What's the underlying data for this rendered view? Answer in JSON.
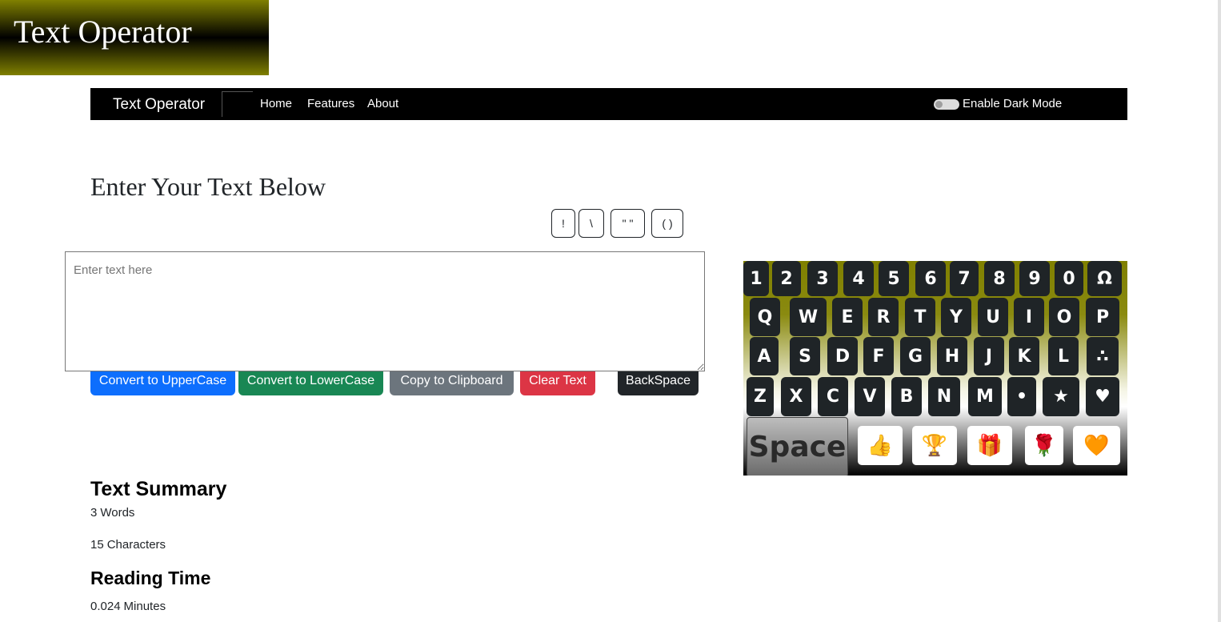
{
  "site_title": "Text Operator",
  "navbar": {
    "brand": "Text Operator",
    "links": [
      "Home",
      "Features",
      "About"
    ],
    "dark_mode_label": "Enable Dark Mode"
  },
  "main": {
    "heading": "Enter Your Text Below",
    "symbol_buttons": [
      "!",
      "\\",
      "\" \"",
      "( )"
    ],
    "textarea_placeholder": "Enter text here",
    "actions": {
      "upper": "Convert to UpperCase",
      "lower": "Convert to LowerCase",
      "copy": "Copy to Clipboard",
      "clear": "Clear Text",
      "backspace": "BackSpace"
    }
  },
  "keyboard": {
    "row1": [
      "1",
      "2",
      "3",
      "4",
      "5",
      "6",
      "7",
      "8",
      "9",
      "0",
      "Ω"
    ],
    "row2": [
      "Q",
      "W",
      "E",
      "R",
      "T",
      "Y",
      "U",
      "I",
      "O",
      "P"
    ],
    "row3": [
      "A",
      "S",
      "D",
      "F",
      "G",
      "H",
      "J",
      "K",
      "L",
      "∴"
    ],
    "row4": [
      "Z",
      "X",
      "C",
      "V",
      "B",
      "N",
      "M",
      "•",
      "★",
      "♥"
    ],
    "space": "Space",
    "emojis": [
      "👍",
      "🏆",
      "🎁",
      "🌹",
      "🧡"
    ]
  },
  "summary": {
    "heading": "Text Summary",
    "words": "3",
    "words_label": "Words",
    "characters": "15",
    "characters_label": "Characters",
    "reading_heading": "Reading Time",
    "reading_time": "0.024",
    "reading_unit": "Minutes"
  },
  "colors": {
    "upper": "#0d6efd",
    "lower": "#198754",
    "copy": "#6c757d",
    "clear": "#dc3545",
    "backspace": "#212529"
  }
}
